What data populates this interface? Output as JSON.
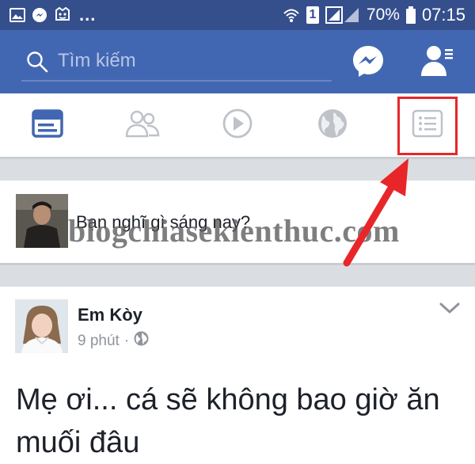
{
  "status_bar": {
    "more": "...",
    "sim": "1",
    "battery": "70%",
    "time": "07:15",
    "icons": [
      "image-icon",
      "messenger-notif-icon",
      "app-notif-icon",
      "wifi-icon",
      "signal-icon",
      "battery-icon"
    ]
  },
  "header": {
    "search_placeholder": "Tìm kiếm",
    "brand_color": "#4267b2"
  },
  "tabs": {
    "items": [
      "news-feed",
      "friends",
      "watch",
      "notifications-globe",
      "menu"
    ],
    "active": "news-feed"
  },
  "composer": {
    "prompt": "Bạn nghĩ gì sáng nay?"
  },
  "post": {
    "author": "Em Kòy",
    "time": "9 phút",
    "separator": "·",
    "text": "Mẹ ơi... cá sẽ không bao giờ ăn muối đâu"
  },
  "watermark": "blogchiasekienthuc.com",
  "annotation_color": "#e8262a"
}
